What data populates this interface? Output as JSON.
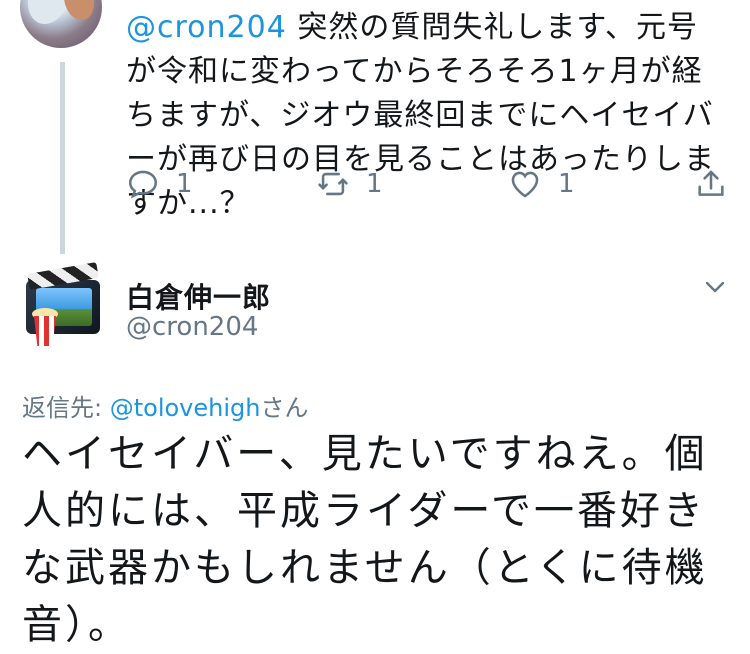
{
  "reply": {
    "mention": "@cron204",
    "text": " 突然の質問失礼します、元号が令和に変わってからそろそろ1ヶ月が経ちますが、ジオウ最終回までにヘイセイバーが再び日の目を見ることはあったりしますか...？",
    "reply_count": "1",
    "retweet_count": "1",
    "like_count": "1"
  },
  "tweet": {
    "display_name": "白倉伸一郎",
    "handle": "@cron204",
    "replying_prefix": "返信先: ",
    "replying_mention": "@tolovehigh",
    "replying_suffix": "さん",
    "text": "ヘイセイバー、見たいですねえ。個人的には、平成ライダーで一番好きな武器かもしれません（とくに待機音）。"
  },
  "icons": {
    "reply": "reply-icon",
    "retweet": "retweet-icon",
    "like": "heart-icon",
    "share": "share-icon",
    "more": "chevron-down-icon"
  },
  "colors": {
    "accent": "#1b95e0",
    "secondary_text": "#657786",
    "thread_line": "#ccd6dd"
  }
}
